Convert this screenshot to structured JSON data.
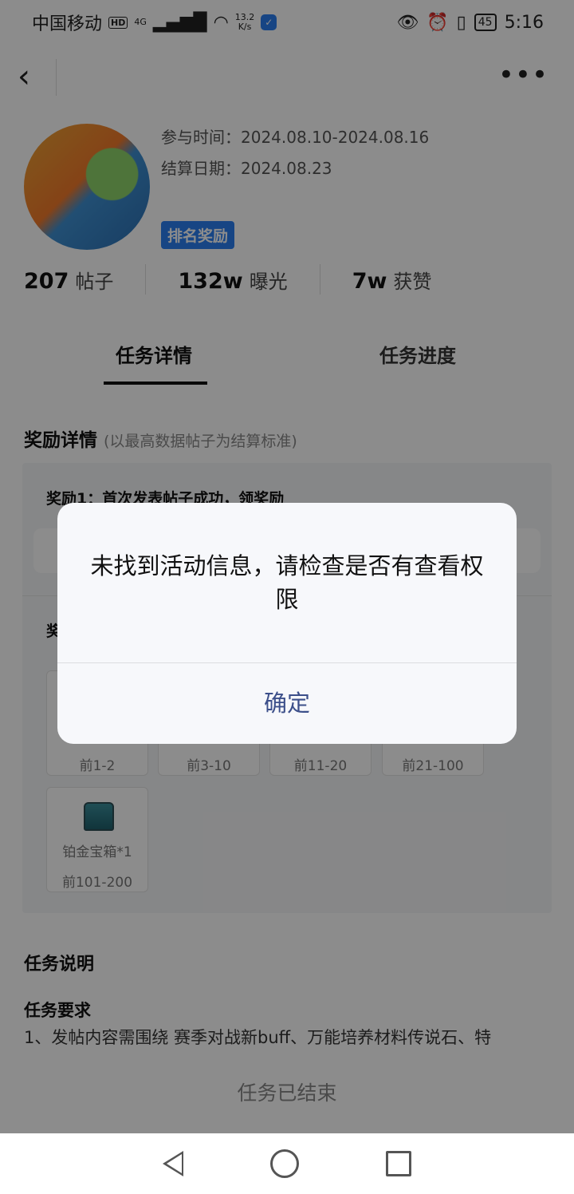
{
  "status": {
    "carrier": "中国移动",
    "hd": "HD",
    "net": "4G",
    "speed_top": "13.2",
    "speed_unit": "K/s",
    "battery": "45",
    "time": "5:16"
  },
  "header": {
    "join_time_label": "参与时间：",
    "join_time_value": "2024.08.10-2024.08.16",
    "settle_label": "结算日期：",
    "settle_value": "2024.08.23",
    "badge": "排名奖励"
  },
  "stats": [
    {
      "num": "207",
      "label": "帖子"
    },
    {
      "num": "132w",
      "label": "曝光"
    },
    {
      "num": "7w",
      "label": "获赞"
    }
  ],
  "tabs": {
    "detail": "任务详情",
    "progress": "任务进度"
  },
  "reward": {
    "title": "奖励详情",
    "subtitle": "(以最高数据帖子为结算标准)",
    "r1": "奖励1：首次发表帖子成功，领奖励",
    "r2": "奖",
    "prizes": [
      {
        "name": "",
        "rank": "前1-2"
      },
      {
        "name": "",
        "rank": "前3-10"
      },
      {
        "name": "",
        "rank": "前11-20"
      },
      {
        "name": "",
        "rank": "前21-100"
      },
      {
        "name": "铂金宝箱*1",
        "rank": "前101-200"
      }
    ]
  },
  "task": {
    "title": "任务说明",
    "req": "任务要求",
    "line": "1、发帖内容需围绕 赛季对战新buff、万能培养材料传说石、特",
    "ended": "任务已结束"
  },
  "dialog": {
    "message": "未找到活动信息，请检查是否有查看权限",
    "confirm": "确定"
  }
}
